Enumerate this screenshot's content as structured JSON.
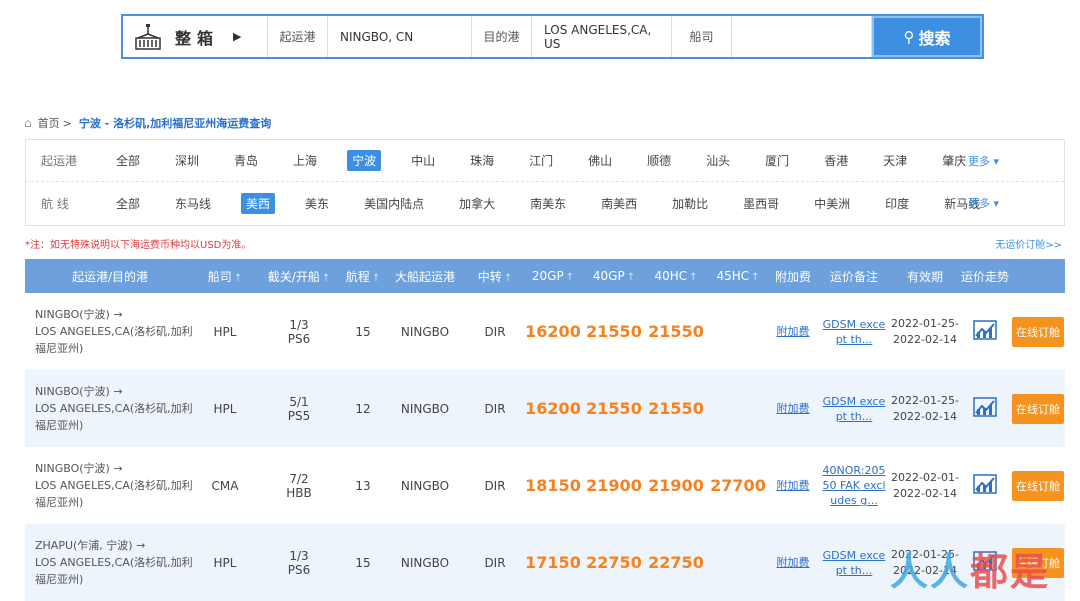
{
  "search": {
    "type_label": "整箱",
    "origin_label": "起运港",
    "origin_value": "NINGBO, CN",
    "dest_label": "目的港",
    "dest_value": "LOS ANGELES,CA, US",
    "carrier_label": "船司",
    "carrier_value": "",
    "button_label": "搜索"
  },
  "breadcrumb": {
    "home": "首页",
    "sep": ">",
    "current": "宁波 - 洛杉矶,加利福尼亚州海运费查询"
  },
  "filters": {
    "origin": {
      "label": "起运港",
      "items": [
        "全部",
        "深圳",
        "青岛",
        "上海",
        "宁波",
        "中山",
        "珠海",
        "江门",
        "佛山",
        "顺德",
        "汕头",
        "厦门",
        "香港",
        "天津",
        "肇庆"
      ],
      "active": "宁波",
      "more": "更多"
    },
    "route": {
      "label": "航 线",
      "items": [
        "全部",
        "东马线",
        "美西",
        "美东",
        "美国内陆点",
        "加拿大",
        "南美东",
        "南美西",
        "加勒比",
        "墨西哥",
        "中美洲",
        "印度",
        "新马线"
      ],
      "active": "美西",
      "more": "更多"
    }
  },
  "note": "*注：如无特殊说明以下海运费币种均以USD为准。",
  "no_rate_link": "无运价订舱>>",
  "table": {
    "headers": [
      "起运港/目的港",
      "船司",
      "截关/开船",
      "航程",
      "大船起运港",
      "中转",
      "20GP",
      "40GP",
      "40HC",
      "45HC",
      "附加费",
      "运价备注",
      "有效期",
      "运价走势",
      ""
    ],
    "rows": [
      {
        "route_line1": "NINGBO(宁波) →",
        "route_line2": "LOS ANGELES,CA(洛杉矶,加利",
        "route_line3": "福尼亚州)",
        "carrier": "HPL",
        "cutoff": "1/3",
        "sail": "PS6",
        "days": "15",
        "port": "NINGBO",
        "transit": "DIR",
        "gp20": "16200",
        "gp40": "21550",
        "hc40": "21550",
        "hc45": "",
        "surcharge": "附加费",
        "remark": "GDSM exce pt th...",
        "valid_from": "2022-01-25-",
        "valid_to": "2022-02-14",
        "book": "在线订舱"
      },
      {
        "route_line1": "NINGBO(宁波) →",
        "route_line2": "LOS ANGELES,CA(洛杉矶,加利",
        "route_line3": "福尼亚州)",
        "carrier": "HPL",
        "cutoff": "5/1",
        "sail": "PS5",
        "days": "12",
        "port": "NINGBO",
        "transit": "DIR",
        "gp20": "16200",
        "gp40": "21550",
        "hc40": "21550",
        "hc45": "",
        "surcharge": "附加费",
        "remark": "GDSM exce pt th...",
        "valid_from": "2022-01-25-",
        "valid_to": "2022-02-14",
        "book": "在线订舱"
      },
      {
        "route_line1": "NINGBO(宁波) →",
        "route_line2": "LOS ANGELES,CA(洛杉矶,加利",
        "route_line3": "福尼亚州)",
        "carrier": "CMA",
        "cutoff": "7/2",
        "sail": "HBB",
        "days": "13",
        "port": "NINGBO",
        "transit": "DIR",
        "gp20": "18150",
        "gp40": "21900",
        "hc40": "21900",
        "hc45": "27700",
        "surcharge": "附加费",
        "remark": "40NOR:205 50 FAK excl udes g...",
        "valid_from": "2022-02-01-",
        "valid_to": "2022-02-14",
        "book": "在线订舱"
      },
      {
        "route_line1": "ZHAPU(乍浦, 宁波) →",
        "route_line2": "LOS ANGELES,CA(洛杉矶,加利",
        "route_line3": "福尼亚州)",
        "carrier": "HPL",
        "cutoff": "1/3",
        "sail": "PS6",
        "days": "15",
        "port": "NINGBO",
        "transit": "DIR",
        "gp20": "17150",
        "gp40": "22750",
        "hc40": "22750",
        "hc45": "",
        "surcharge": "附加费",
        "remark": "GDSM exce pt th...",
        "valid_from": "2022-01-25-",
        "valid_to": "2022-02-14",
        "book": "在线订舱"
      }
    ]
  },
  "watermark": {
    "part1": "人人",
    "part2": "都是"
  },
  "colors": {
    "accent": "#3d8fe2",
    "header": "#6ea1db",
    "price": "#f5821f",
    "book": "#f6931e",
    "note": "#e03c3c"
  }
}
